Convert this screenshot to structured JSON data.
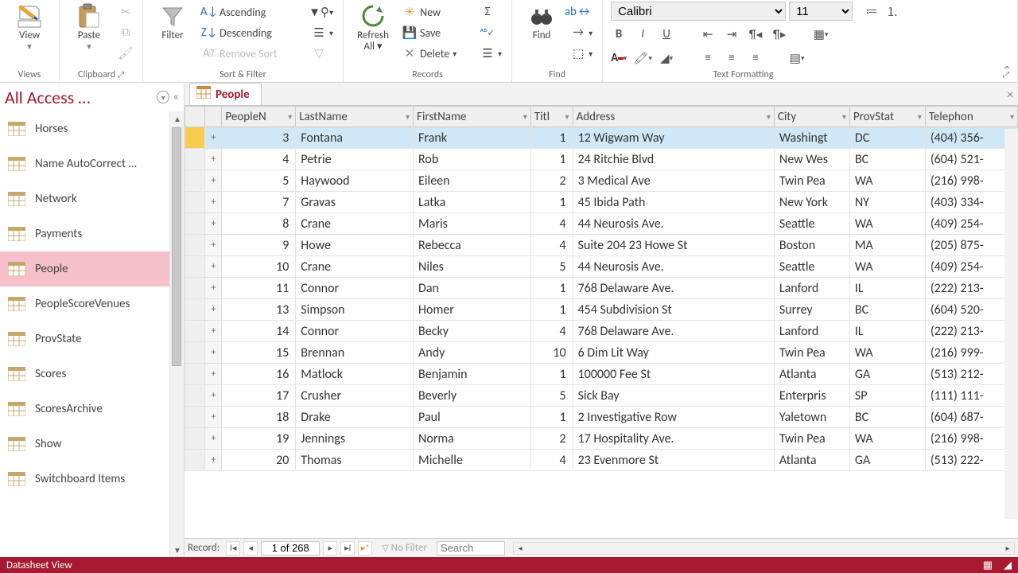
{
  "ribbon": {
    "view": "View",
    "views_group": "Views",
    "paste": "Paste",
    "clipboard_group": "Clipboard",
    "filter": "Filter",
    "ascending": "Ascending",
    "descending": "Descending",
    "remove_sort": "Remove Sort",
    "sort_group": "Sort & Filter",
    "refresh": "Refresh All",
    "new": "New",
    "save": "Save",
    "delete": "Delete",
    "records_group": "Records",
    "find": "Find",
    "find_group": "Find",
    "font_name": "Calibri",
    "font_size": "11",
    "tf_group": "Text Formatting"
  },
  "nav": {
    "title": "All Access …",
    "items": [
      "Horses",
      "Name AutoCorrect …",
      "Network",
      "Payments",
      "People",
      "PeopleScoreVenues",
      "ProvState",
      "Scores",
      "ScoresArchive",
      "Show",
      "Switchboard Items"
    ],
    "selected_index": 4
  },
  "tab": {
    "label": "People"
  },
  "columns": [
    "PeopleN",
    "LastName",
    "FirstName",
    "Titl",
    "Address",
    "City",
    "ProvStat",
    "Telephon"
  ],
  "rows": [
    {
      "id": 3,
      "last": "Fontana",
      "first": "Frank",
      "title": 1,
      "addr": "12 Wigwam Way",
      "city": "Washingt",
      "prov": "DC",
      "tel": "(404) 356-"
    },
    {
      "id": 4,
      "last": "Petrie",
      "first": "Rob",
      "title": 1,
      "addr": "24 Ritchie Blvd",
      "city": "New Wes",
      "prov": "BC",
      "tel": "(604) 521-"
    },
    {
      "id": 5,
      "last": "Haywood",
      "first": "Eileen",
      "title": 2,
      "addr": "3 Medical Ave",
      "city": "Twin Pea",
      "prov": "WA",
      "tel": "(216) 998-"
    },
    {
      "id": 7,
      "last": "Gravas",
      "first": "Latka",
      "title": 1,
      "addr": "45 Ibida Path",
      "city": "New York",
      "prov": "NY",
      "tel": "(403) 334-"
    },
    {
      "id": 8,
      "last": "Crane",
      "first": "Maris",
      "title": 4,
      "addr": "44 Neurosis Ave.",
      "city": "Seattle",
      "prov": "WA",
      "tel": "(409) 254-"
    },
    {
      "id": 9,
      "last": "Howe",
      "first": "Rebecca",
      "title": 4,
      "addr": "Suite 204 23 Howe St",
      "city": "Boston",
      "prov": "MA",
      "tel": "(205) 875-"
    },
    {
      "id": 10,
      "last": "Crane",
      "first": "Niles",
      "title": 5,
      "addr": "44 Neurosis Ave.",
      "city": "Seattle",
      "prov": "WA",
      "tel": "(409) 254-"
    },
    {
      "id": 11,
      "last": "Connor",
      "first": "Dan",
      "title": 1,
      "addr": "768 Delaware Ave.",
      "city": "Lanford",
      "prov": "IL",
      "tel": "(222) 213-"
    },
    {
      "id": 13,
      "last": "Simpson",
      "first": "Homer",
      "title": 1,
      "addr": "454 Subdivision St",
      "city": "Surrey",
      "prov": "BC",
      "tel": "(604) 520-"
    },
    {
      "id": 14,
      "last": "Connor",
      "first": "Becky",
      "title": 4,
      "addr": "768 Delaware Ave.",
      "city": "Lanford",
      "prov": "IL",
      "tel": "(222) 213-"
    },
    {
      "id": 15,
      "last": "Brennan",
      "first": "Andy",
      "title": 10,
      "addr": "6 Dim Lit Way",
      "city": "Twin Pea",
      "prov": "WA",
      "tel": "(216) 999-"
    },
    {
      "id": 16,
      "last": "Matlock",
      "first": "Benjamin",
      "title": 1,
      "addr": "100000 Fee St",
      "city": "Atlanta",
      "prov": "GA",
      "tel": "(513) 212-"
    },
    {
      "id": 17,
      "last": "Crusher",
      "first": "Beverly",
      "title": 5,
      "addr": "Sick Bay",
      "city": "Enterpris",
      "prov": "SP",
      "tel": "(111) 111-"
    },
    {
      "id": 18,
      "last": "Drake",
      "first": "Paul",
      "title": 1,
      "addr": "2 Investigative Row",
      "city": "Yaletown",
      "prov": "BC",
      "tel": "(604) 687-"
    },
    {
      "id": 19,
      "last": "Jennings",
      "first": "Norma",
      "title": 2,
      "addr": "17 Hospitality Ave.",
      "city": "Twin Pea",
      "prov": "WA",
      "tel": "(216) 998-"
    },
    {
      "id": 20,
      "last": "Thomas",
      "first": "Michelle",
      "title": 4,
      "addr": "23 Evenmore St",
      "city": "Atlanta",
      "prov": "GA",
      "tel": "(513) 222-"
    }
  ],
  "recnav": {
    "label": "Record:",
    "position": "1 of 268",
    "nofilter": "No Filter",
    "search": "Search"
  },
  "status": {
    "view": "Datasheet View"
  }
}
